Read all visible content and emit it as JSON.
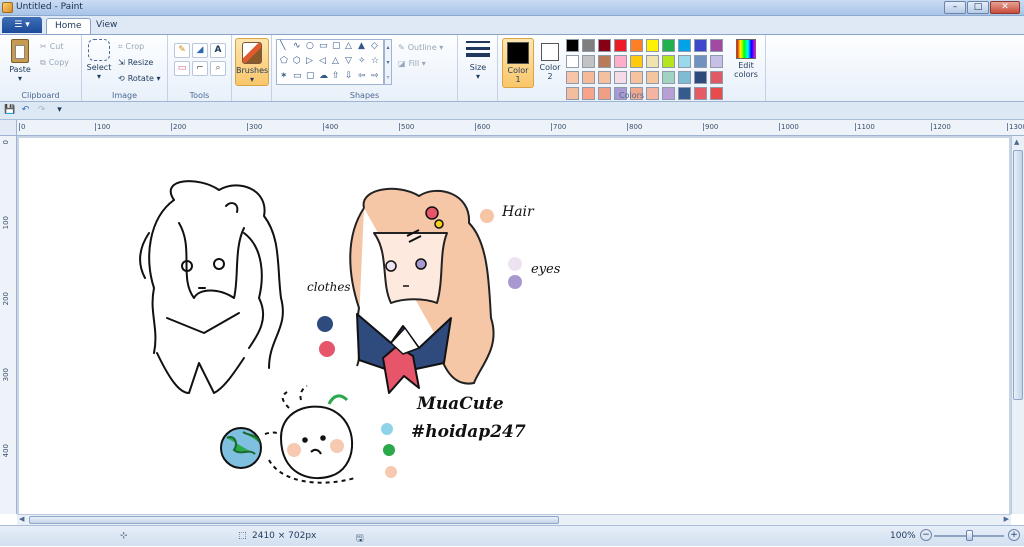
{
  "window": {
    "title": "Untitled - Paint",
    "minimize": "–",
    "maximize": "□",
    "close": "✕"
  },
  "tabs": {
    "file": "☰ ▾",
    "home": "Home",
    "view": "View"
  },
  "clipboard": {
    "label": "Clipboard",
    "paste": "Paste",
    "cut": "Cut",
    "copy": "Copy"
  },
  "image": {
    "label": "Image",
    "select": "Select",
    "crop": "Crop",
    "resize": "Resize",
    "rotate": "Rotate ▾"
  },
  "tools": {
    "label": "Tools",
    "pencil": "✎",
    "fill": "◢",
    "text": "A",
    "eraser": "▭",
    "picker": "⌐",
    "magnifier": "⌕"
  },
  "brushes": {
    "label": "Brushes"
  },
  "shapes": {
    "label": "Shapes",
    "outline": "Outline ▾",
    "fill": "Fill ▾",
    "glyphs": [
      "╲",
      "∿",
      "○",
      "▭",
      "▢",
      "△",
      "▲",
      "◇",
      "⬠",
      "⬡",
      "▷",
      "◁",
      "△",
      "▽",
      "✧",
      "☆",
      "✶",
      "▭",
      "▢",
      "☁",
      "⇧",
      "⇩",
      "⇦",
      "⇨"
    ]
  },
  "size": {
    "label": "Size"
  },
  "colors": {
    "label": "Colors",
    "color1": "Color 1",
    "color2": "Color 2",
    "edit": "Edit colors",
    "color1_value": "#000000",
    "color2_value": "#ffffff",
    "palette": [
      "#000000",
      "#7f7f7f",
      "#880015",
      "#ed1c24",
      "#ff7f27",
      "#fff200",
      "#22b14c",
      "#00a2e8",
      "#3f48cc",
      "#a349a4",
      "#ffffff",
      "#c3c3c3",
      "#b97a57",
      "#ffaec9",
      "#ffc90e",
      "#efe4b0",
      "#b5e61d",
      "#99d9ea",
      "#7092be",
      "#c8bfe7",
      "#f9c5a8",
      "#f6b99a",
      "#f4c09f",
      "#f6dbe6",
      "#f7c39d",
      "#f5c69e",
      "#a2d3c2",
      "#7fbbd4",
      "#2d4a7a",
      "#e05a66",
      "#f4bda0",
      "#f7a48a",
      "#f29d85",
      "#a99bd2",
      "#f2a98b",
      "#f6b4a0",
      "#b89fd6",
      "#375a8c",
      "#e45b65",
      "#e74c4c"
    ]
  },
  "ruler": {
    "top": [
      "0",
      "100",
      "200",
      "300",
      "400",
      "500",
      "600",
      "700",
      "800",
      "900",
      "1000",
      "1100",
      "1200",
      "1300"
    ],
    "left": [
      "0",
      "100",
      "200",
      "300",
      "400"
    ]
  },
  "drawing": {
    "hair_label": "Hair",
    "eyes_label": "eyes",
    "clothes_label": "clothes",
    "signature": "MuaCute",
    "hashtag": "#hoidap247",
    "hair_swatch": "#f7c4a6",
    "eye_light": "#ede3f0",
    "eye_dark": "#a798cf",
    "cloth_navy": "#2f4a7c",
    "cloth_red": "#e6556a",
    "ball_blue": "#8fd3e8",
    "ball_green": "#2aa84a",
    "ball_peach": "#f7c9b0"
  },
  "status": {
    "dimensions": "2410 × 702px",
    "zoom": "100%"
  }
}
